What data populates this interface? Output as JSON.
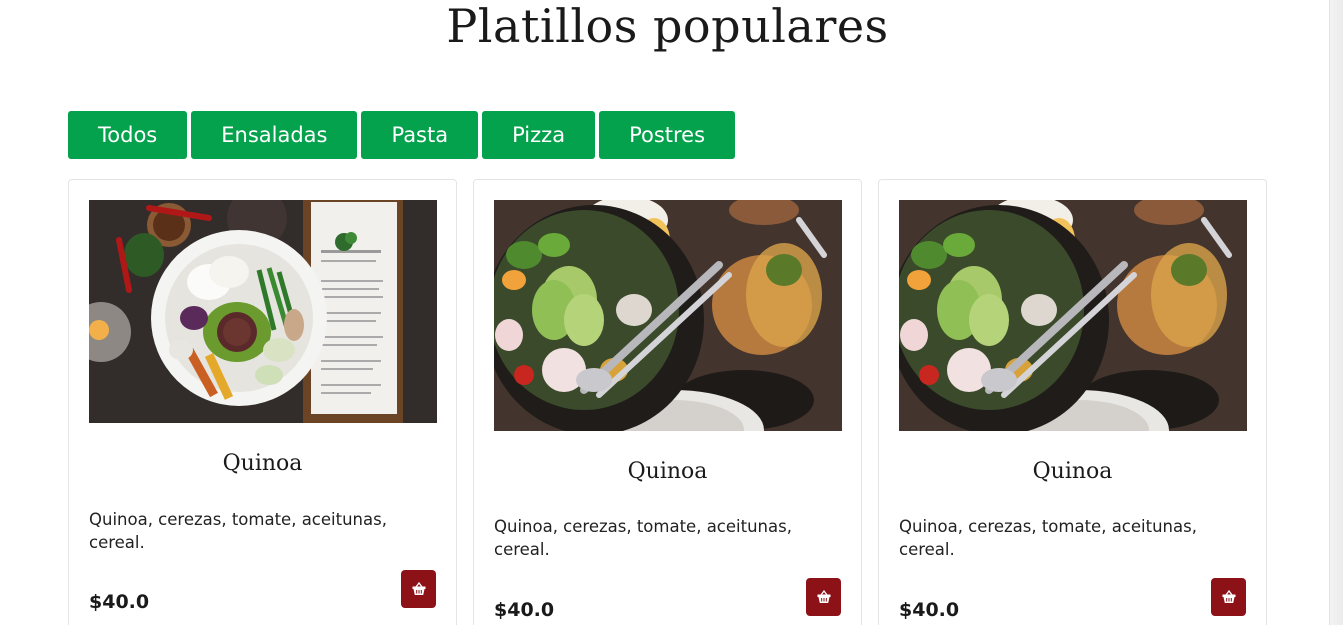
{
  "page": {
    "title": "Platillos populares"
  },
  "filters": [
    {
      "label": "Todos"
    },
    {
      "label": "Ensaladas"
    },
    {
      "label": "Pasta"
    },
    {
      "label": "Pizza"
    },
    {
      "label": "Postres"
    }
  ],
  "cards": [
    {
      "title": "Quinoa",
      "description": "Quinoa, cerezas, tomate, aceitunas, cereal.",
      "price": "$40.0",
      "image": "quinoa-bowl-with-menu",
      "cart_icon": "basket-icon"
    },
    {
      "title": "Quinoa",
      "description": "Quinoa, cerezas, tomate, aceitunas, cereal.",
      "price": "$40.0",
      "image": "avocado-salad-with-juice",
      "cart_icon": "basket-icon"
    },
    {
      "title": "Quinoa",
      "description": "Quinoa, cerezas, tomate, aceitunas, cereal.",
      "price": "$40.0",
      "image": "avocado-salad-with-juice",
      "cart_icon": "basket-icon"
    }
  ],
  "colors": {
    "filter_bg": "#04a24c",
    "cart_bg": "#8c1218"
  }
}
